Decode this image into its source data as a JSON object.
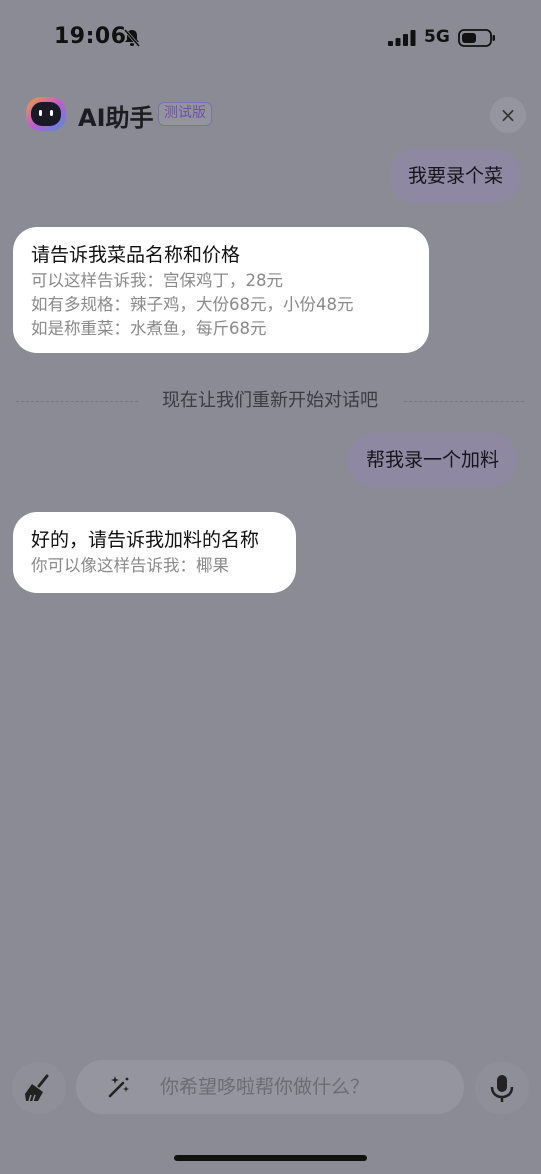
{
  "status_bar": {
    "time": "19:06",
    "network": "5G",
    "icons": [
      "bell-slash-icon",
      "signal-icon",
      "battery-icon"
    ]
  },
  "header": {
    "title": "AI助手",
    "badge": "测试版",
    "close_label": "×",
    "logo_icon": "robot-logo-icon"
  },
  "messages": [
    {
      "role": "user",
      "text": "我要录个菜"
    },
    {
      "role": "assistant",
      "title": "请告诉我菜品名称和价格",
      "lines": [
        "可以这样告诉我：宫保鸡丁，28元",
        "如有多规格：辣子鸡，大份68元，小份48元",
        "如是称重菜：水煮鱼，每斤68元"
      ]
    },
    {
      "role": "divider",
      "text": "现在让我们重新开始对话吧"
    },
    {
      "role": "user",
      "text": "帮我录一个加料"
    },
    {
      "role": "assistant",
      "title": "好的，请告诉我加料的名称",
      "lines": [
        "你可以像这样告诉我：椰果"
      ]
    }
  ],
  "input": {
    "placeholder": "你希望哆啦帮你做什么？",
    "left_icon": "broom-icon",
    "magic_icon": "magic-wand-icon",
    "right_icon": "microphone-icon"
  },
  "colors": {
    "overlay": "#8b8b95",
    "user_bubble": "#8f88a2",
    "assistant_bubble": "#ffffff",
    "badge": "#6f4fb0"
  }
}
